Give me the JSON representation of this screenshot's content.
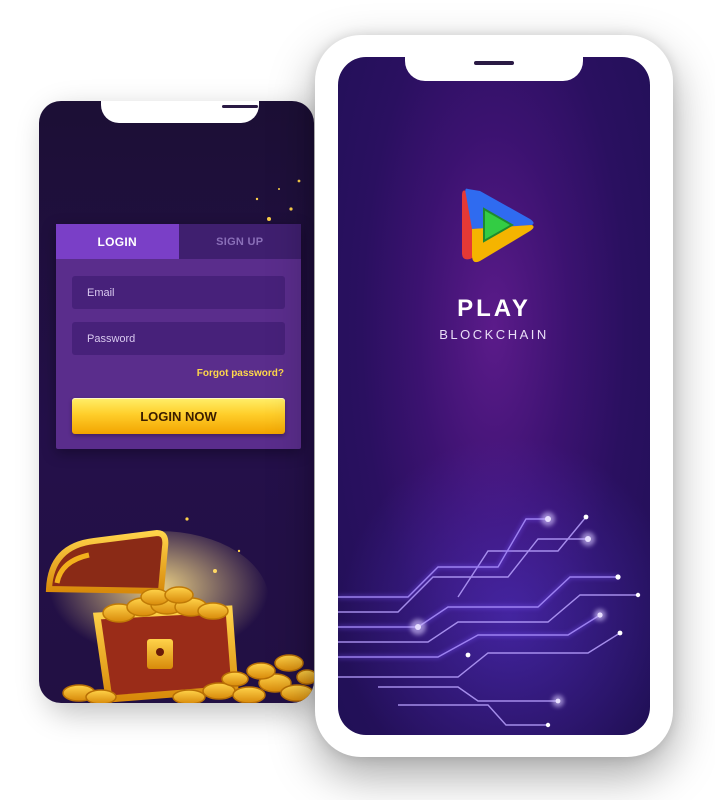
{
  "login_screen": {
    "tabs": {
      "login": "LOGIN",
      "signup": "SIGN UP"
    },
    "email_placeholder": "Email",
    "password_placeholder": "Password",
    "forgot_password": "Forgot password?",
    "login_button": "LOGIN NOW"
  },
  "splash_screen": {
    "title": "PLAY",
    "subtitle": "BLOCKCHAIN"
  },
  "colors": {
    "accent_purple": "#7a3fc7",
    "button_gold": "#ffce2a",
    "link_yellow": "#ffd84a"
  },
  "icons": [
    "play-logo-icon",
    "treasure-chest-icon",
    "circuit-lines-graphic"
  ]
}
